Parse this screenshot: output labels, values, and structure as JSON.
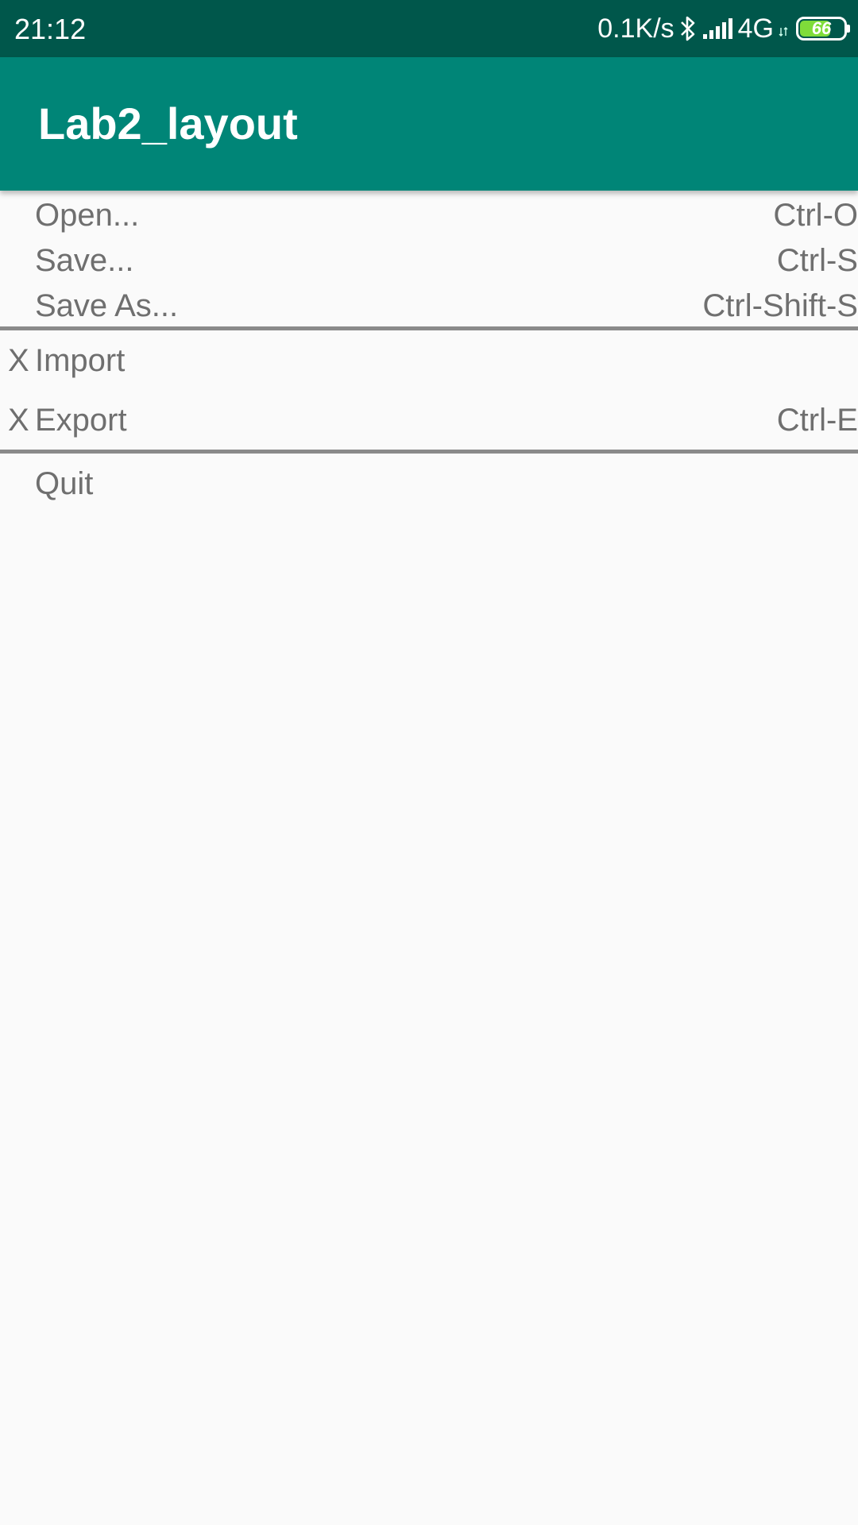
{
  "status_bar": {
    "time": "21:12",
    "net_speed": "0.1K/s",
    "network_type": "4G",
    "battery_level": "66",
    "icons": [
      "bluetooth-icon",
      "signal-icon",
      "battery-icon"
    ]
  },
  "app_bar": {
    "title": "Lab2_layout",
    "color": "#008577"
  },
  "menu": {
    "group1": [
      {
        "label": "Open...",
        "shortcut": "Ctrl-O"
      },
      {
        "label": "Save...",
        "shortcut": "Ctrl-S"
      },
      {
        "label": "Save As...",
        "shortcut": "Ctrl-Shift-S"
      }
    ],
    "group2": [
      {
        "check": "X",
        "label": "Import",
        "shortcut": ""
      },
      {
        "check": "X",
        "label": "Export",
        "shortcut": "Ctrl-E"
      }
    ],
    "group3": [
      {
        "label": "Quit"
      }
    ]
  }
}
